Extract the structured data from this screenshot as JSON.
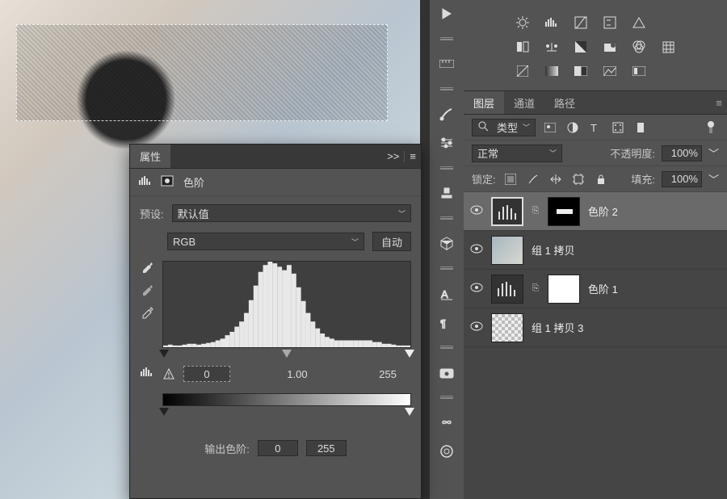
{
  "properties": {
    "title": "属性",
    "collapse_glyph": ">>",
    "type_label": "色阶",
    "preset_label": "预设:",
    "preset_value": "默认值",
    "channel_value": "RGB",
    "auto_label": "自动",
    "input_black": "0",
    "input_gamma": "1.00",
    "input_white": "255",
    "output_label": "输出色阶:",
    "output_black": "0",
    "output_white": "255"
  },
  "layers_panel": {
    "tabs": [
      "图层",
      "通道",
      "路径"
    ],
    "filter_label": "类型",
    "blend_mode": "正常",
    "opacity_label": "不透明度:",
    "opacity_value": "100%",
    "lock_label": "锁定:",
    "fill_label": "填充:",
    "fill_value": "100%",
    "layers": [
      {
        "name": "色阶 2",
        "kind": "levels",
        "hasMask": true,
        "selected": true
      },
      {
        "name": "组 1 拷贝",
        "kind": "image",
        "hasMask": false,
        "selected": false
      },
      {
        "name": "色阶 1",
        "kind": "levels",
        "hasMask": true,
        "selected": false,
        "whiteMask": true
      },
      {
        "name": "组 1 拷贝 3",
        "kind": "image-checker",
        "hasMask": false,
        "selected": false
      }
    ]
  },
  "chart_data": {
    "type": "bar",
    "title": "",
    "xlabel": "",
    "ylabel": "",
    "xlim": [
      0,
      255
    ],
    "categories_note": "luminance 0-255, 52 approximate bins",
    "values": [
      2,
      3,
      2,
      2,
      3,
      4,
      4,
      3,
      4,
      5,
      6,
      8,
      10,
      14,
      18,
      24,
      30,
      40,
      55,
      72,
      88,
      96,
      100,
      98,
      94,
      90,
      96,
      86,
      70,
      54,
      40,
      30,
      22,
      16,
      12,
      10,
      8,
      8,
      8,
      8,
      8,
      8,
      8,
      8,
      6,
      6,
      4,
      4,
      3,
      2,
      2,
      2
    ],
    "input_markers": {
      "black": 0,
      "gamma": 1.0,
      "white": 255
    },
    "output_markers": {
      "black": 0,
      "white": 255
    }
  }
}
